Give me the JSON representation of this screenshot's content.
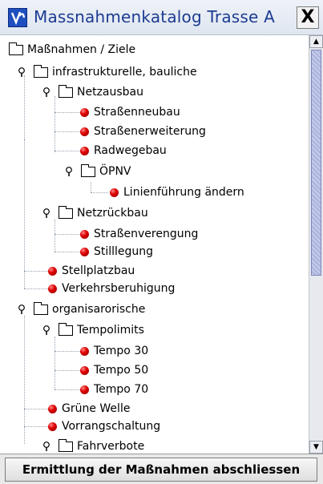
{
  "window": {
    "title": "Massnahmenkatalog Trasse A",
    "close_label": "X",
    "app_icon": "v-logo-icon"
  },
  "tree": {
    "root": "Maßnahmen / Ziele",
    "items": [
      {
        "label": "infrastrukturelle, bauliche",
        "kind": "folder"
      },
      {
        "label": "Netzausbau",
        "kind": "folder"
      },
      {
        "label": "Straßenneubau",
        "kind": "leaf"
      },
      {
        "label": "Straßenerweiterung",
        "kind": "leaf"
      },
      {
        "label": "Radwegebau",
        "kind": "leaf"
      },
      {
        "label": "ÖPNV",
        "kind": "folder"
      },
      {
        "label": "Linienführung ändern",
        "kind": "leaf"
      },
      {
        "label": "Netzrückbau",
        "kind": "folder"
      },
      {
        "label": "Straßenverengung",
        "kind": "leaf"
      },
      {
        "label": "Stilllegung",
        "kind": "leaf"
      },
      {
        "label": "Stellplatzbau",
        "kind": "leaf"
      },
      {
        "label": "Verkehrsberuhigung",
        "kind": "leaf"
      },
      {
        "label": "organisarorische",
        "kind": "folder"
      },
      {
        "label": "Tempolimits",
        "kind": "folder"
      },
      {
        "label": "Tempo 30",
        "kind": "leaf"
      },
      {
        "label": "Tempo 50",
        "kind": "leaf"
      },
      {
        "label": "Tempo 70",
        "kind": "leaf"
      },
      {
        "label": "Grüne Welle",
        "kind": "leaf"
      },
      {
        "label": "Vorrangschaltung",
        "kind": "leaf"
      },
      {
        "label": "Fahrverbote",
        "kind": "folder"
      }
    ]
  },
  "scrollbar": {
    "up_arrow": "▲",
    "down_arrow": "▼"
  },
  "footer": {
    "button_label": "Ermittlung der Maßnahmen abschliessen"
  }
}
